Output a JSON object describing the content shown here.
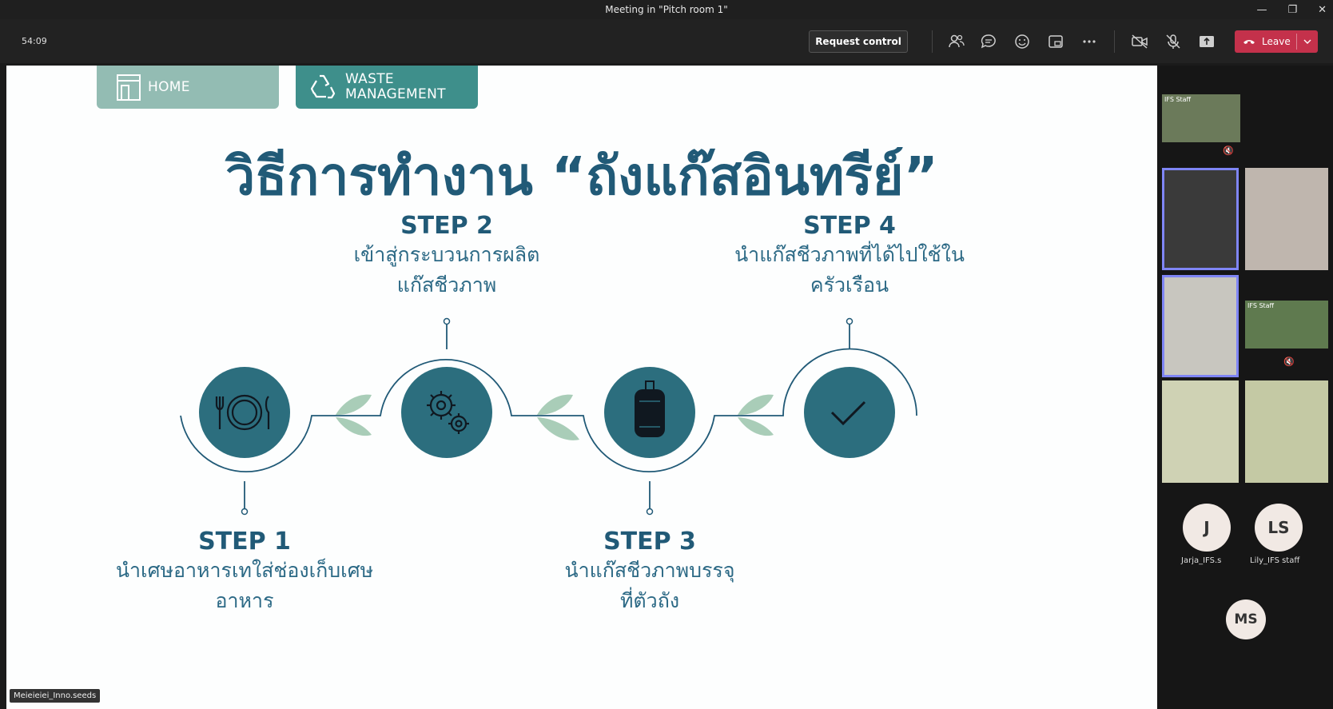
{
  "window": {
    "title": "Meeting in \"Pitch room 1\""
  },
  "toolbar": {
    "timer": "54:09",
    "request_control_label": "Request control",
    "leave_label": "Leave"
  },
  "slide": {
    "tabs": [
      {
        "label": "HOME"
      },
      {
        "label_line1": "WASTE",
        "label_line2": "MANAGEMENT"
      }
    ],
    "title": "วิธีการทำงาน “ถังแก๊สอินทรีย์”",
    "steps": [
      {
        "title": "STEP 1",
        "line1": "นำเศษอาหารเทใส่ช่องเก็บเศษ",
        "line2": "อาหาร"
      },
      {
        "title": "STEP 2",
        "line1": "เข้าสู่กระบวนการผลิต",
        "line2": "แก๊สชีวภาพ"
      },
      {
        "title": "STEP 3",
        "line1": "นำแก๊สชีวภาพบรรจุ",
        "line2": "ที่ตัวถัง"
      },
      {
        "title": "STEP 4",
        "line1": "นำแก๊สชีวภาพที่ได้ไปใช้ใน",
        "line2": "ครัวเรือน"
      }
    ],
    "colors": {
      "primary": "#215a77",
      "circle": "#2c6e7e",
      "leaf": "#a9cdb8"
    }
  },
  "presenter": {
    "name": "Meieieiei_Inno.seeds"
  },
  "participants": {
    "tile_labels": [
      "IFS Staff",
      "IFS Staff"
    ],
    "avatars": [
      {
        "initials": "J",
        "name": "Jarja_IFS.s"
      },
      {
        "initials": "LS",
        "name": "Lily_IFS staff"
      },
      {
        "initials": "MS",
        "name": ""
      }
    ]
  }
}
